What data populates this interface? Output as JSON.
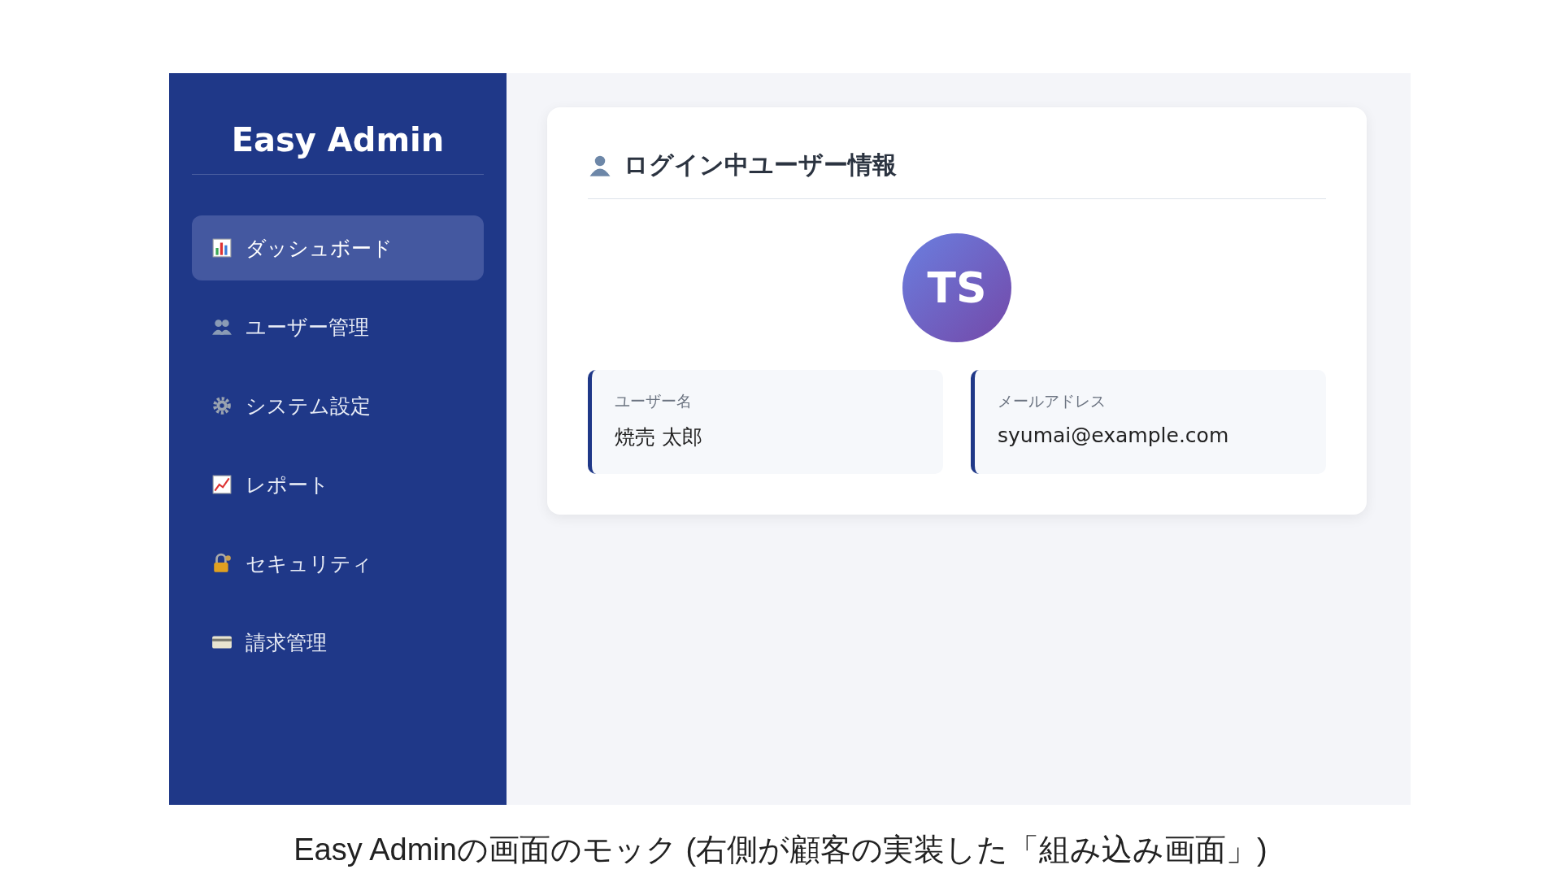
{
  "sidebar": {
    "logo": "Easy Admin",
    "items": [
      {
        "label": "ダッシュボード",
        "selected": true
      },
      {
        "label": "ユーザー管理",
        "selected": false
      },
      {
        "label": "システム設定",
        "selected": false
      },
      {
        "label": "レポート",
        "selected": false
      },
      {
        "label": "セキュリティ",
        "selected": false
      },
      {
        "label": "請求管理",
        "selected": false
      }
    ]
  },
  "card": {
    "title": "ログイン中ユーザー情報",
    "avatar_initials": "TS",
    "fields": [
      {
        "label": "ユーザー名",
        "value": "焼売 太郎"
      },
      {
        "label": "メールアドレス",
        "value": "syumai@example.com"
      }
    ]
  },
  "caption": "Easy Adminの画面のモック (右側が顧客の実装した「組み込み画面」)"
}
